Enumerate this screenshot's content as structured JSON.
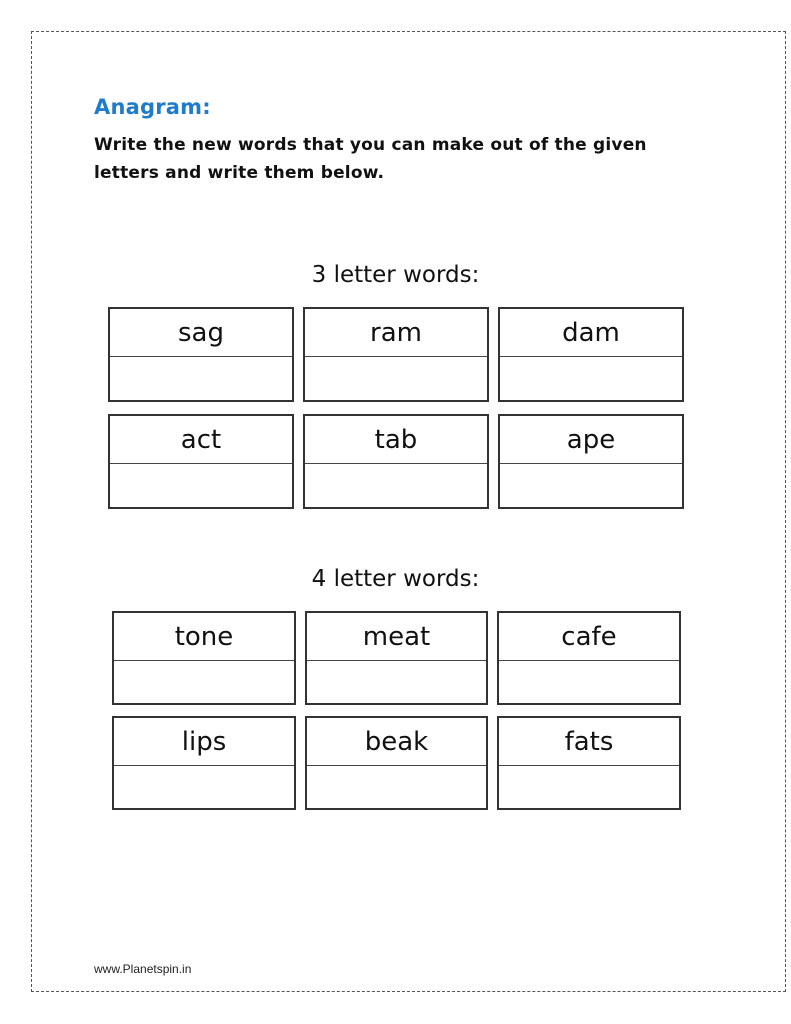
{
  "title": "Anagram:",
  "instructions": "Write the new words that you can make out of the given letters and write them below.",
  "sections": [
    {
      "heading": "3 letter words:",
      "words": [
        "sag",
        "ram",
        "dam",
        "act",
        "tab",
        "ape"
      ]
    },
    {
      "heading": "4 letter words:",
      "words": [
        "tone",
        "meat",
        "cafe",
        "lips",
        "beak",
        "fats"
      ]
    }
  ],
  "footer": "www.Planetspin.in",
  "colors": {
    "title": "#1f7ccc",
    "text": "#111111",
    "border": "#333333"
  }
}
